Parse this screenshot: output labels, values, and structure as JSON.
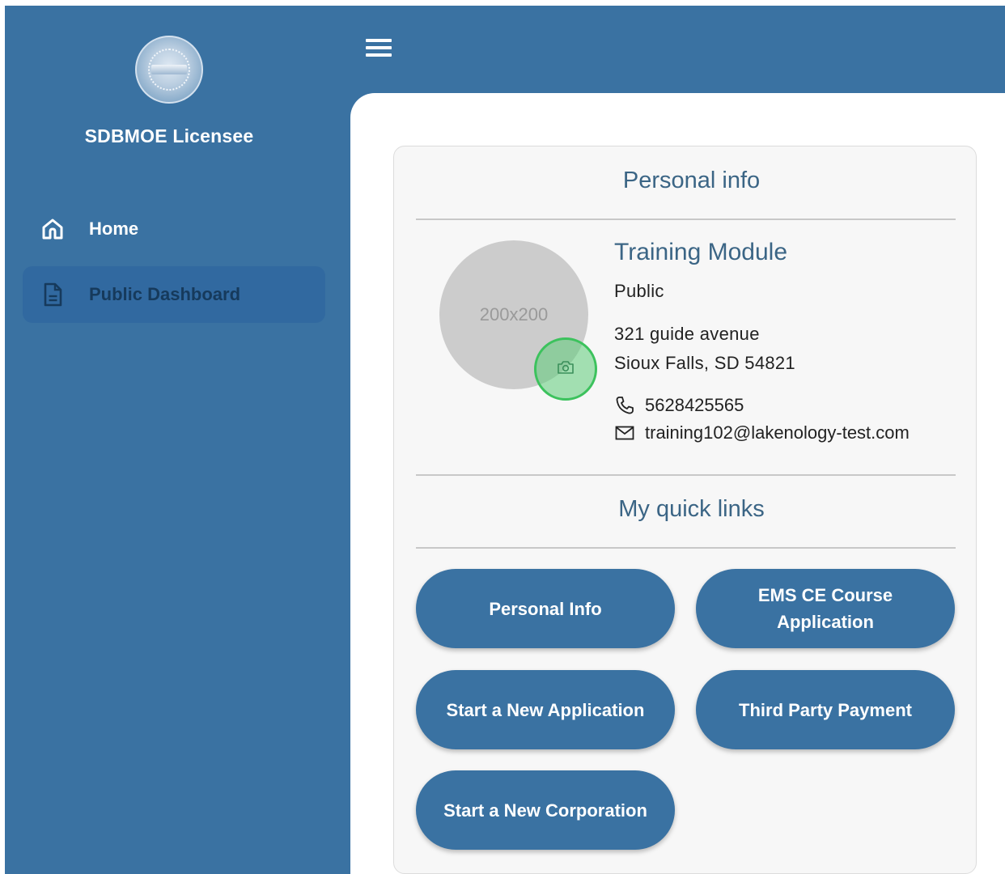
{
  "app": {
    "brand": "SDBMOE Licensee"
  },
  "sidebar": {
    "items": [
      {
        "label": "Home",
        "icon": "home-icon",
        "active": false
      },
      {
        "label": "Public Dashboard",
        "icon": "document-icon",
        "active": true
      }
    ]
  },
  "profile": {
    "section_title": "Personal info",
    "avatar_placeholder": "200x200",
    "name": "Training Module",
    "role": "Public",
    "address_line1": "321 guide avenue",
    "address_line2": "Sioux Falls, SD 54821",
    "phone": "5628425565",
    "email": "training102@lakenology-test.com"
  },
  "quick_links": {
    "section_title": "My quick links",
    "buttons": [
      {
        "label": "Personal Info"
      },
      {
        "label": "EMS CE Course Application"
      },
      {
        "label": "Start a New Application"
      },
      {
        "label": "Third Party Payment"
      },
      {
        "label": "Start a New Corporation"
      }
    ]
  },
  "colors": {
    "primary": "#3a72a2",
    "heading": "#3b6585",
    "highlight": "#3cc25d"
  }
}
